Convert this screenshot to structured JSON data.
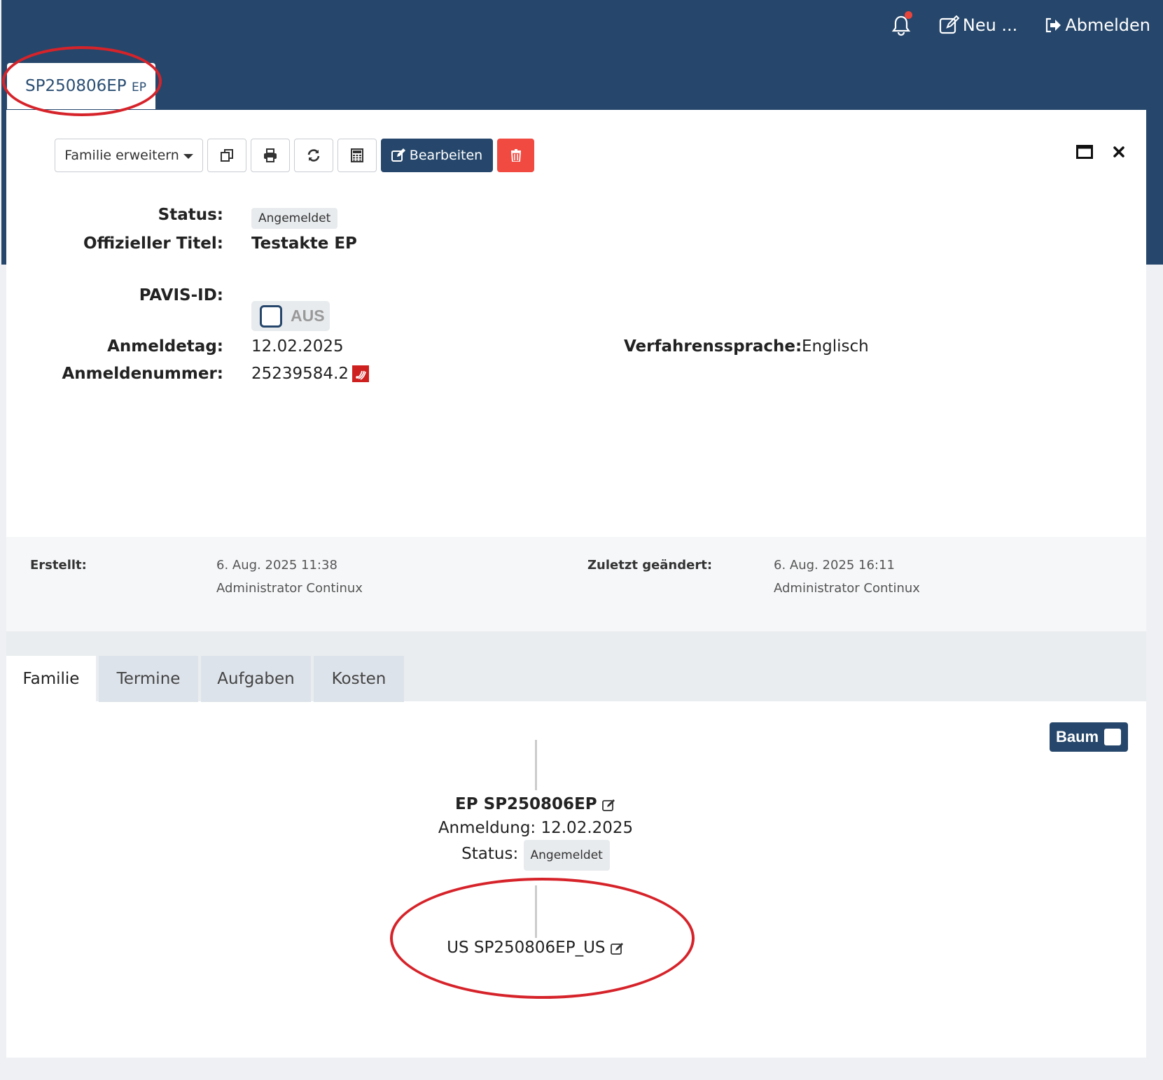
{
  "topnav": {
    "new_label": "Neu ...",
    "logout_label": "Abmelden"
  },
  "doc_tab": {
    "id": "SP250806EP",
    "type": "EP"
  },
  "toolbar": {
    "family_dropdown": "Familie erweitern",
    "edit_label": "Bearbeiten"
  },
  "fields": {
    "status_label": "Status:",
    "status_value": "Angemeldet",
    "title_label": "Offizieller Titel:",
    "title_value": "Testakte EP",
    "pavis_label": "PAVIS-ID:",
    "pavis_toggle": "AUS",
    "filing_date_label": "Anmeldetag:",
    "filing_date_value": "12.02.2025",
    "app_number_label": "Anmeldenummer:",
    "app_number_value": "25239584.2",
    "language_label": "Verfahrenssprache:",
    "language_value": "Englisch"
  },
  "meta": {
    "created_label": "Erstellt:",
    "created_date": "6. Aug. 2025 11:38",
    "created_by": "Administrator Continux",
    "modified_label": "Zuletzt geändert:",
    "modified_date": "6. Aug. 2025 16:11",
    "modified_by": "Administrator Continux"
  },
  "tabs": [
    "Familie",
    "Termine",
    "Aufgaben",
    "Kosten"
  ],
  "tree": {
    "toggle_label": "Baum",
    "root_title": "EP SP250806EP",
    "root_filing": "Anmeldung: 12.02.2025",
    "root_status_label": "Status:",
    "root_status": "Angemeldet",
    "child_title": "US SP250806EP_US"
  },
  "colors": {
    "header": "#26476b",
    "delete": "#f14a41",
    "annotation": "#d6232a"
  }
}
